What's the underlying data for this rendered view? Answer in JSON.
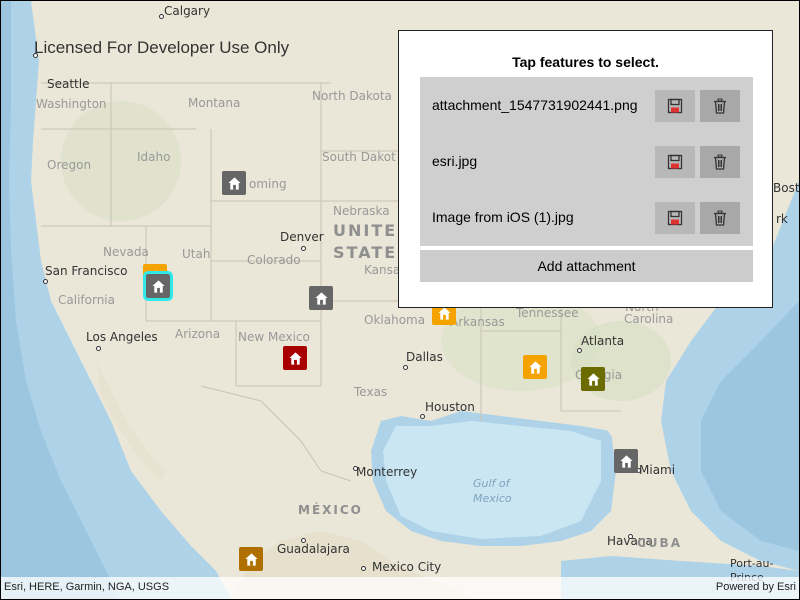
{
  "map": {
    "watermark": "Licensed For Developer Use Only",
    "colors": {
      "land": "#eae6d8",
      "water": "#aed2e8",
      "shallow_water": "#c9e6f2",
      "border": "#c9c3b4",
      "selection": "#30e8e8"
    },
    "labels": {
      "calgary": "Calgary",
      "seattle": "Seattle",
      "washington": "Washington",
      "oregon": "Oregon",
      "idaho": "Idaho",
      "montana": "Montana",
      "north_dakota": "North Dakota",
      "south_dakota": "South Dakot",
      "wyoming": "oming",
      "nebraska": "Nebraska",
      "united_states_1": "UNITE",
      "united_states_2": "STATE",
      "denver": "Denver",
      "kansas": "Kansa",
      "nevada": "Nevada",
      "utah": "Utah",
      "colorado": "Colorado",
      "san_francisco": "San Francisco",
      "california": "California",
      "los_angeles": "Los Angeles",
      "arizona": "Arizona",
      "new_mexico": "New Mexico",
      "oklahoma": "Oklahoma",
      "arkansas": "Arkansas",
      "tennessee": "Tennessee",
      "north_carolina": "North",
      "carolina": "Carolina",
      "atlanta": "Atlanta",
      "georgia": "Georgia",
      "dallas": "Dallas",
      "texas": "Texas",
      "houston": "Houston",
      "monterrey": "Monterrey",
      "gulf_1": "Gulf of",
      "gulf_2": "Mexico",
      "miami": "Miami",
      "mexico": "MÉXICO",
      "havana": "Havana",
      "cuba": "CUBA",
      "guadalajara": "Guadalajara",
      "mexico_city": "Mexico City",
      "port_au": "Port-au-",
      "prince": "Prince",
      "boston": "Bosto",
      "york": "rk"
    },
    "markers": [
      {
        "name": "marker-wyoming",
        "color": "#666666",
        "selected": false
      },
      {
        "name": "marker-nevada-orange",
        "color": "#f5a300",
        "selected": false
      },
      {
        "name": "marker-nevada-selected",
        "color": "#666666",
        "selected": true
      },
      {
        "name": "marker-colorado",
        "color": "#666666",
        "selected": false
      },
      {
        "name": "marker-new-mexico",
        "color": "#a80000",
        "selected": false
      },
      {
        "name": "marker-arkansas",
        "color": "#f5a300",
        "selected": false
      },
      {
        "name": "marker-alabama",
        "color": "#f5a300",
        "selected": false
      },
      {
        "name": "marker-georgia",
        "color": "#6b6b00",
        "selected": false
      },
      {
        "name": "marker-florida",
        "color": "#666666",
        "selected": false
      },
      {
        "name": "marker-mexico",
        "color": "#b07000",
        "selected": false
      }
    ]
  },
  "panel": {
    "title": "Tap features to select.",
    "attachments": [
      {
        "name": "attachment_1547731902441.png",
        "save_icon": "save-icon",
        "delete_icon": "trash-icon"
      },
      {
        "name": "esri.jpg",
        "save_icon": "save-icon",
        "delete_icon": "trash-icon"
      },
      {
        "name": "Image from iOS (1).jpg",
        "save_icon": "save-icon",
        "delete_icon": "trash-icon"
      }
    ],
    "add_label": "Add attachment"
  },
  "attribution": {
    "left": "Esri, HERE, Garmin, NGA, USGS",
    "right": "Powered by Esri"
  }
}
